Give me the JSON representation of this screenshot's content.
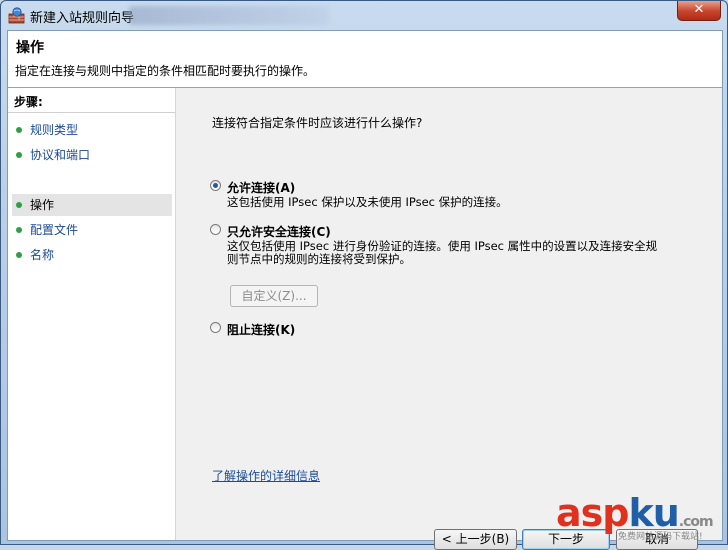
{
  "window": {
    "title": "新建入站规则向导",
    "close_glyph": "✕"
  },
  "header": {
    "title": "操作",
    "description": "指定在连接与规则中指定的条件相匹配时要执行的操作。"
  },
  "steps": {
    "heading": "步骤:",
    "items": [
      {
        "label": "规则类型",
        "active": false
      },
      {
        "label": "协议和端口",
        "active": false
      },
      {
        "label": "操作",
        "active": true
      },
      {
        "label": "配置文件",
        "active": false
      },
      {
        "label": "名称",
        "active": false
      }
    ]
  },
  "main": {
    "question": "连接符合指定条件时应该进行什么操作?",
    "options": [
      {
        "label": "允许连接(A)",
        "description": "这包括使用 IPsec 保护以及未使用 IPsec 保护的连接。",
        "checked": true
      },
      {
        "label": "只允许安全连接(C)",
        "description": "这仅包括使用 IPsec 进行身份验证的连接。使用 IPsec 属性中的设置以及连接安全规则节点中的规则的连接将受到保护。",
        "checked": false
      },
      {
        "label": "阻止连接(K)",
        "description": "",
        "checked": false
      }
    ],
    "customize_button": "自定义(Z)...",
    "learn_more_link": "了解操作的详细信息"
  },
  "buttons": {
    "back": "< 上一步(B)",
    "next": "下一步",
    "cancel": "取消"
  },
  "watermark": {
    "asp": "asp",
    "ku": "ku",
    "dotcom": ".com",
    "sub": "免费网站源码下载站!"
  },
  "colors": {
    "link": "#1a4a9a",
    "step_dot": "#2ea043",
    "radio_fill": "#2456a8",
    "close_red": "#c7432c",
    "wm_red": "#e0301e",
    "wm_blue": "#1f5fa8"
  },
  "icons": {
    "app": "firewall-shield-icon",
    "close": "close-icon"
  }
}
